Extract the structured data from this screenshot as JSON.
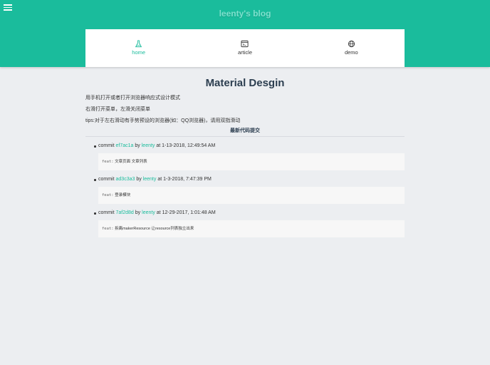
{
  "header": {
    "title": "leenty's blog",
    "colors": {
      "primary": "#1abc9c",
      "title": "#7de0cd"
    }
  },
  "nav": {
    "items": [
      {
        "label": "home",
        "icon": "flask-icon",
        "active": true
      },
      {
        "label": "article",
        "icon": "browser-window-icon",
        "active": false
      },
      {
        "label": "demo",
        "icon": "globe-icon",
        "active": false
      }
    ]
  },
  "main": {
    "title": "Material Desgin",
    "paragraphs": [
      "用手机打开或者打开浏览器响应式设计模式",
      "右滑打开菜单，左滑关闭菜单",
      "tips:对于左右滑动有手势预设的浏览器(如：QQ浏览器)，请用双指滑动"
    ],
    "commits_title": "最新代码提交",
    "commits": [
      {
        "prefix": "commit",
        "hash": "ef7ac1a",
        "by": "by",
        "author": "leenty",
        "at": "at 1-13-2018, 12:49:54 AM",
        "type": "feat:",
        "message": "文章页面 文章列表"
      },
      {
        "prefix": "commit",
        "hash": "ad3c3a3",
        "by": "by",
        "author": "leenty",
        "at": "at 1-3-2018, 7:47:39 PM",
        "type": "feat:",
        "message": "登录模块"
      },
      {
        "prefix": "commit",
        "hash": "7af2d8d",
        "by": "by",
        "author": "leenty",
        "at": "at 12-29-2017, 1:01:48 AM",
        "type": "feat:",
        "message": "拆离makerResource 让resource列表独立出来"
      }
    ]
  }
}
